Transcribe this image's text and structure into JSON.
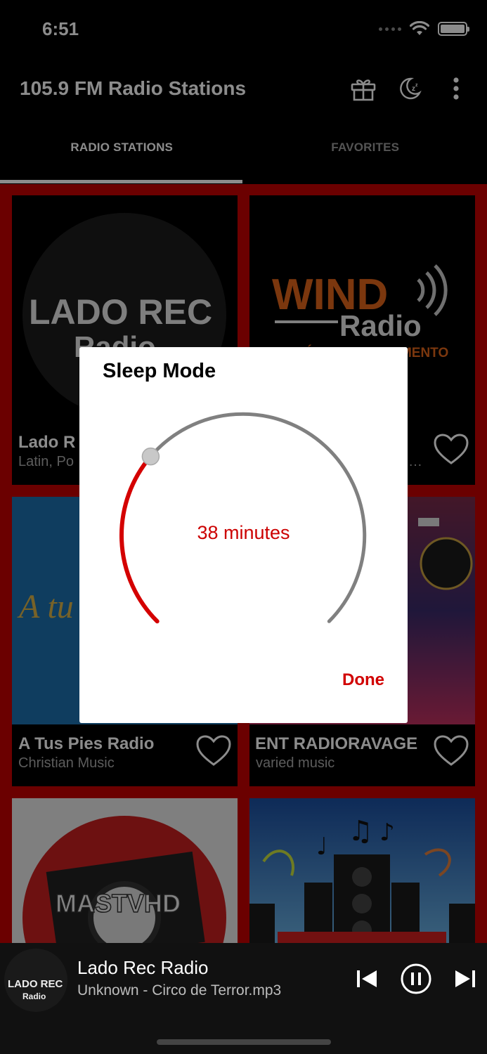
{
  "status_bar": {
    "time": "6:51"
  },
  "app_bar": {
    "title": "105.9 FM Radio Stations",
    "icons": [
      "gift-icon",
      "sleep-moon-icon",
      "more-vertical-icon"
    ]
  },
  "tabs": [
    {
      "label": "RADIO STATIONS",
      "active": true
    },
    {
      "label": "FAVORITES",
      "active": false
    }
  ],
  "stations": [
    {
      "name": "Lado R",
      "genre": "Latin, Po",
      "logo_text": "LADO REC",
      "logo_sub": "Radio",
      "fav_icon": "heart-outline-icon"
    },
    {
      "name": "",
      "genre": "…",
      "logo_text": "WIND",
      "logo_sub": "Radio",
      "tagline": "LA MÚSICA DEL MOMENTO",
      "fav_icon": "heart-outline-icon"
    },
    {
      "name": "A Tus Pies Radio",
      "genre": "Christian Music",
      "logo_text": "A tu",
      "fav_icon": "heart-outline-icon"
    },
    {
      "name": "ENT RADIORAVAGE",
      "genre": "varied music",
      "fav_icon": "heart-outline-icon"
    },
    {
      "name": "",
      "genre": "",
      "logo_text": "MASTVHD"
    },
    {
      "name": "",
      "genre": ""
    }
  ],
  "sleep_dialog": {
    "title": "Sleep Mode",
    "value_label": "38 minutes",
    "minutes": 38,
    "done_label": "Done",
    "accent_color": "#d40000",
    "track_color": "#808080"
  },
  "player": {
    "title": "Lado Rec Radio",
    "subtitle": "Unknown - Circo de Terror.mp3",
    "art_text": "LADO REC",
    "art_sub": "Radio"
  }
}
